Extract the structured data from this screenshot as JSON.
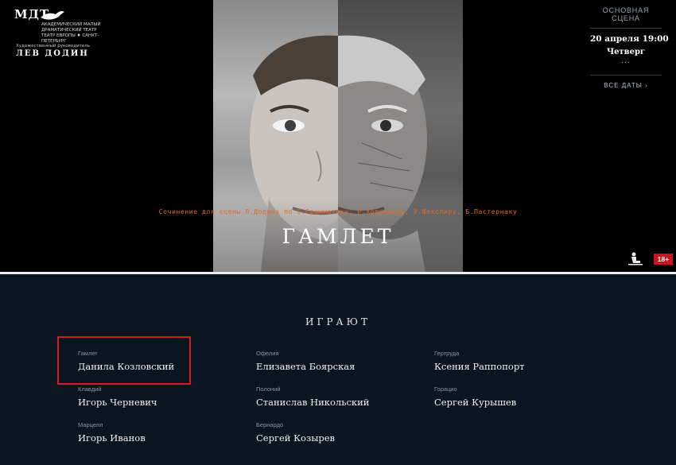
{
  "logo": {
    "mark": "МДТ",
    "subtitle": "АКАДЕМИЧЕСКИЙ МАЛЫЙ ДРАМАТИЧЕСКИЙ ТЕАТР ТЕАТР ЕВРОПЫ ♦ САНКТ-ПЕТЕРБУРГ",
    "director_title": "Художественный руководитель",
    "director_name": "ЛЕВ ДОДИН"
  },
  "schedule": {
    "stage": "ОСНОВНАЯ СЦЕНА",
    "date_time": "20 апреля 19:00",
    "weekday": "Четверг",
    "more": "...",
    "all_dates": "ВСЕ ДАТЫ ›"
  },
  "show": {
    "subtitle": "Сочинение для сцены Л.Додина по С.Грамматику, Р.Холиншеду, У.Шекспиру, Б.Пастернаку",
    "title": "ГАМЛЕТ",
    "age_rating": "18+",
    "accessibility_icon": "accessibility-icon"
  },
  "cast": {
    "heading": "ИГРАЮТ",
    "roles": [
      {
        "character": "Гамлет",
        "actor": "Данила Козловский"
      },
      {
        "character": "Офелия",
        "actor": "Елизавета Боярская"
      },
      {
        "character": "Гертруда",
        "actor": "Ксения Раппопорт"
      },
      {
        "character": "Клавдий",
        "actor": "Игорь Черневич"
      },
      {
        "character": "Полоний",
        "actor": "Станислав Никольский"
      },
      {
        "character": "Горацио",
        "actor": "Сергей Курышев"
      },
      {
        "character": "Марцелл",
        "actor": "Игорь Иванов"
      },
      {
        "character": "Бернардо",
        "actor": "Сергей Козырев"
      }
    ]
  },
  "colors": {
    "accent_orange": "#e46a2e",
    "age_badge_red": "#c8151b",
    "highlight_red": "#d21d22",
    "cast_background": "#0b1520"
  }
}
